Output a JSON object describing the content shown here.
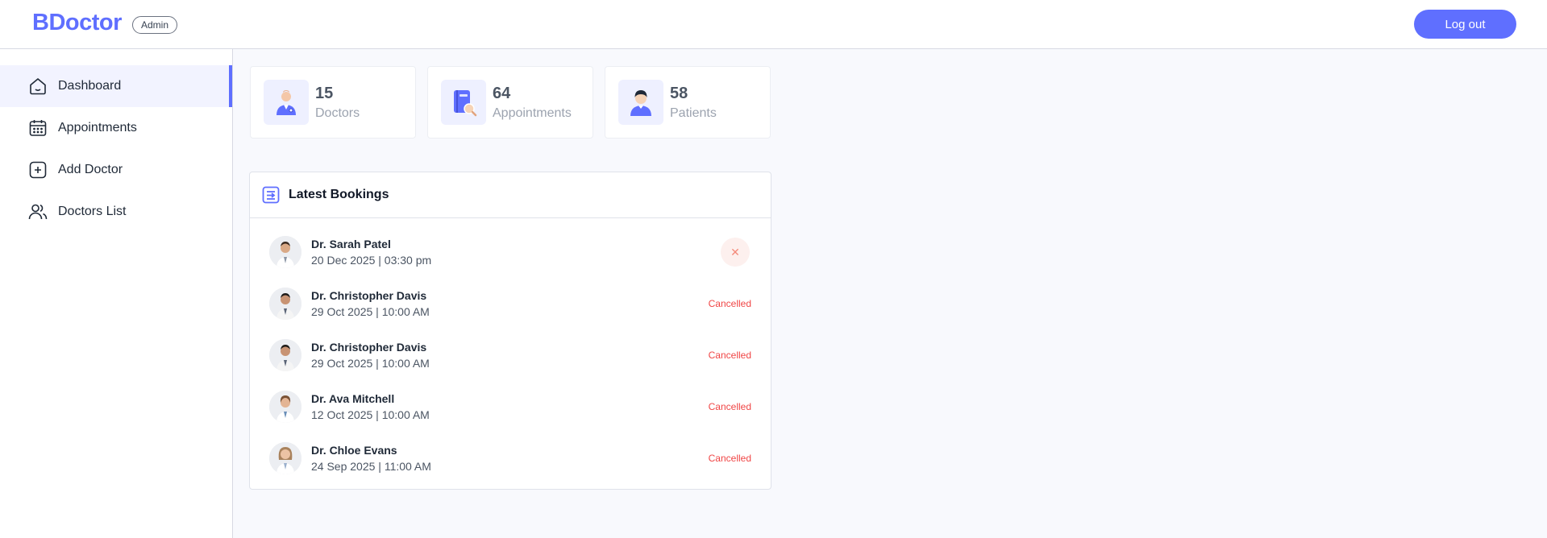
{
  "header": {
    "logo": "BDoctor",
    "badge": "Admin",
    "logout_label": "Log out"
  },
  "sidebar": {
    "items": [
      {
        "label": "Dashboard",
        "icon": "home-icon",
        "active": true
      },
      {
        "label": "Appointments",
        "icon": "calendar-icon",
        "active": false
      },
      {
        "label": "Add Doctor",
        "icon": "add-square-icon",
        "active": false
      },
      {
        "label": "Doctors List",
        "icon": "people-icon",
        "active": false
      }
    ]
  },
  "stats": [
    {
      "value": "15",
      "label": "Doctors",
      "icon": "doctor-icon"
    },
    {
      "value": "64",
      "label": "Appointments",
      "icon": "appointment-book-icon"
    },
    {
      "value": "58",
      "label": "Patients",
      "icon": "patient-icon"
    }
  ],
  "bookings": {
    "title": "Latest Bookings",
    "rows": [
      {
        "name": "Dr. Sarah Patel",
        "date": "20 Dec 2025 | 03:30 pm",
        "status": "",
        "cancel_icon": "close-icon"
      },
      {
        "name": "Dr. Christopher Davis",
        "date": "29 Oct 2025 | 10:00 AM",
        "status": "Cancelled"
      },
      {
        "name": "Dr. Christopher Davis",
        "date": "29 Oct 2025 | 10:00 AM",
        "status": "Cancelled"
      },
      {
        "name": "Dr. Ava Mitchell",
        "date": "12 Oct 2025 | 10:00 AM",
        "status": "Cancelled"
      },
      {
        "name": "Dr. Chloe Evans",
        "date": "24 Sep 2025 | 11:00 AM",
        "status": "Cancelled"
      }
    ]
  },
  "colors": {
    "primary": "#5f6fff",
    "danger": "#f04545",
    "main_bg": "#f8f9fd"
  }
}
